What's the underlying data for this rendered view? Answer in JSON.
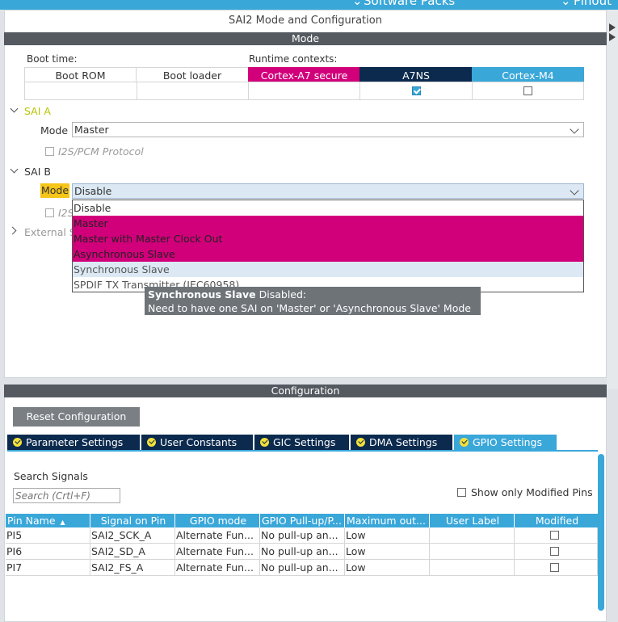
{
  "topbar": {
    "left_fragment": "Software Packs",
    "right_fragment": "Pinout"
  },
  "mode_panel": {
    "title": "SAI2 Mode and Configuration",
    "section_label": "Mode",
    "boot_time_label": "Boot time:",
    "runtime_label": "Runtime contexts:",
    "contexts": [
      {
        "label": "Boot ROM",
        "checked": null
      },
      {
        "label": "Boot loader",
        "checked": null
      },
      {
        "label": "Cortex-A7 secure",
        "checked": null,
        "color": "#d1007a"
      },
      {
        "label": "A7NS",
        "checked": true,
        "color": "#0b2a4e"
      },
      {
        "label": "Cortex-M4",
        "checked": false,
        "color": "#3aa7d9"
      }
    ],
    "sai_a": {
      "label": "SAI A",
      "mode_label": "Mode",
      "mode_value": "Master",
      "protocol_label": "I2S/PCM Protocol"
    },
    "sai_b": {
      "label": "SAI B",
      "mode_label": "Mode",
      "mode_value": "Disable",
      "protocol_label_partial": "I2S"
    },
    "external_partial": "External S",
    "dropdown_options": [
      "Disable",
      "Master",
      "Master with Master Clock Out",
      "Asynchronous Slave",
      "Synchronous Slave",
      "SPDIF TX Transmitter (IEC60958)"
    ],
    "tooltip": {
      "bold": "Synchronous Slave",
      "rest": " Disabled:",
      "line2": "Need to have one SAI on 'Master' or 'Asynchronous Slave' Mode"
    }
  },
  "config_panel": {
    "section_label": "Configuration",
    "reset_button": "Reset Configuration",
    "tabs": [
      "Parameter Settings",
      "User Constants",
      "GIC Settings",
      "DMA Settings",
      "GPIO Settings"
    ],
    "search_label": "Search Signals",
    "search_placeholder": "Search (Crtl+F)",
    "show_modified_label": "Show only Modified Pins",
    "columns": [
      "Pin Name",
      "Signal on Pin",
      "GPIO mode",
      "GPIO Pull-up/P...",
      "Maximum out...",
      "User Label",
      "Modified"
    ],
    "rows": [
      {
        "pin": "PI5",
        "signal": "SAI2_SCK_A",
        "mode": "Alternate Fun...",
        "pull": "No pull-up an...",
        "speed": "Low",
        "label": "",
        "modified": false
      },
      {
        "pin": "PI6",
        "signal": "SAI2_SD_A",
        "mode": "Alternate Fun...",
        "pull": "No pull-up an...",
        "speed": "Low",
        "label": "",
        "modified": false
      },
      {
        "pin": "PI7",
        "signal": "SAI2_FS_A",
        "mode": "Alternate Fun...",
        "pull": "No pull-up an...",
        "speed": "Low",
        "label": "",
        "modified": false
      }
    ]
  },
  "colors": {
    "accent": "#3aa7d9",
    "magenta": "#d1007a",
    "navy": "#0b2a4e",
    "highlight": "#f5c518",
    "section_bar": "#545a60"
  }
}
